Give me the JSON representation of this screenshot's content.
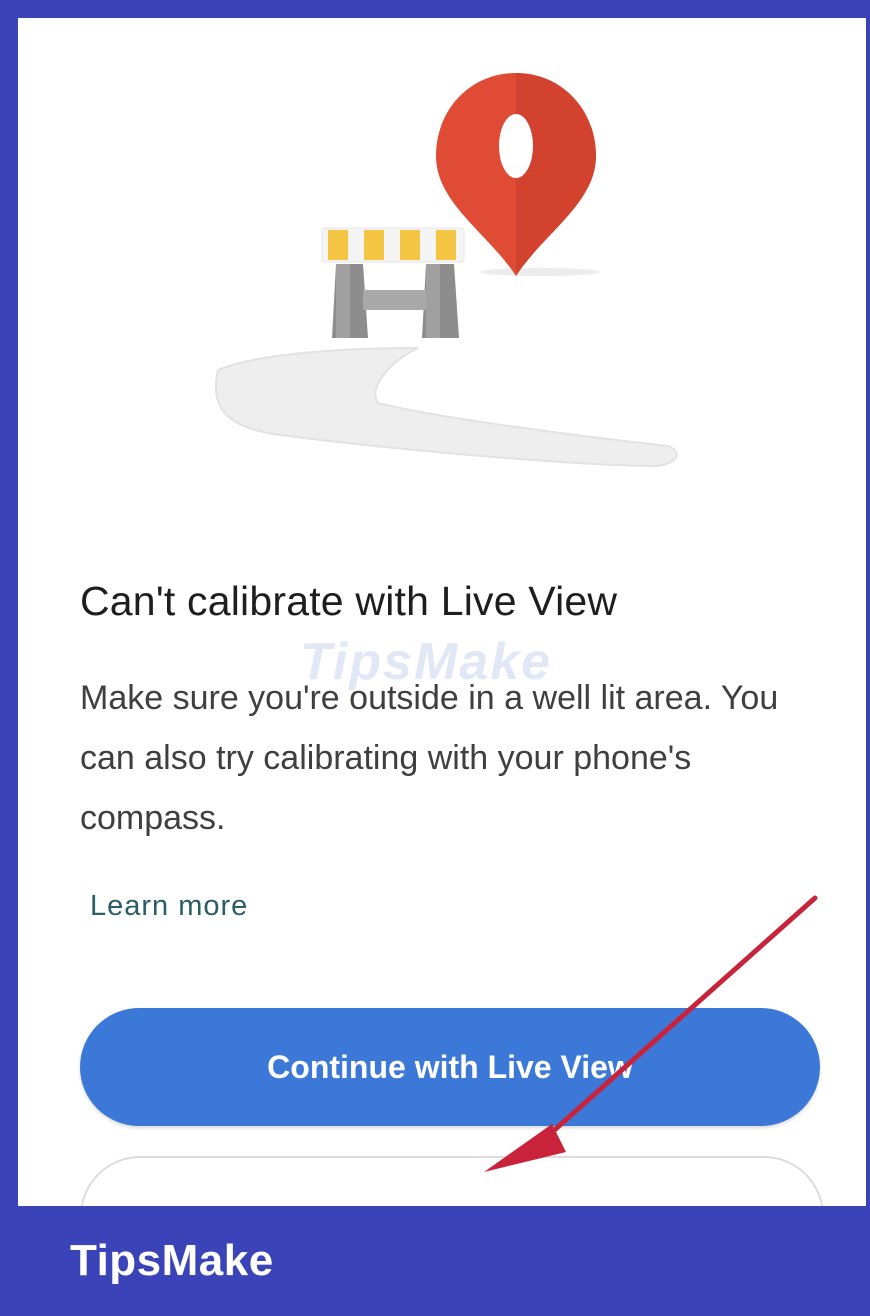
{
  "dialog": {
    "title": "Can't calibrate with Live View",
    "message": "Make sure you're outside in a well lit area. You can also try calibrating with your phone's compass.",
    "learn_more": "Learn more",
    "primary_button": "Continue with Live View"
  },
  "watermark": {
    "text": "TipsMake"
  },
  "illustration": {
    "icons": [
      "map-pin-icon",
      "road-barrier-icon"
    ]
  },
  "colors": {
    "frame": "#3a44b8",
    "primary_button": "#3c78d8",
    "pin": "#e04b35",
    "barrier_stripe": "#f4c542",
    "annotation_arrow": "#c8233a"
  }
}
